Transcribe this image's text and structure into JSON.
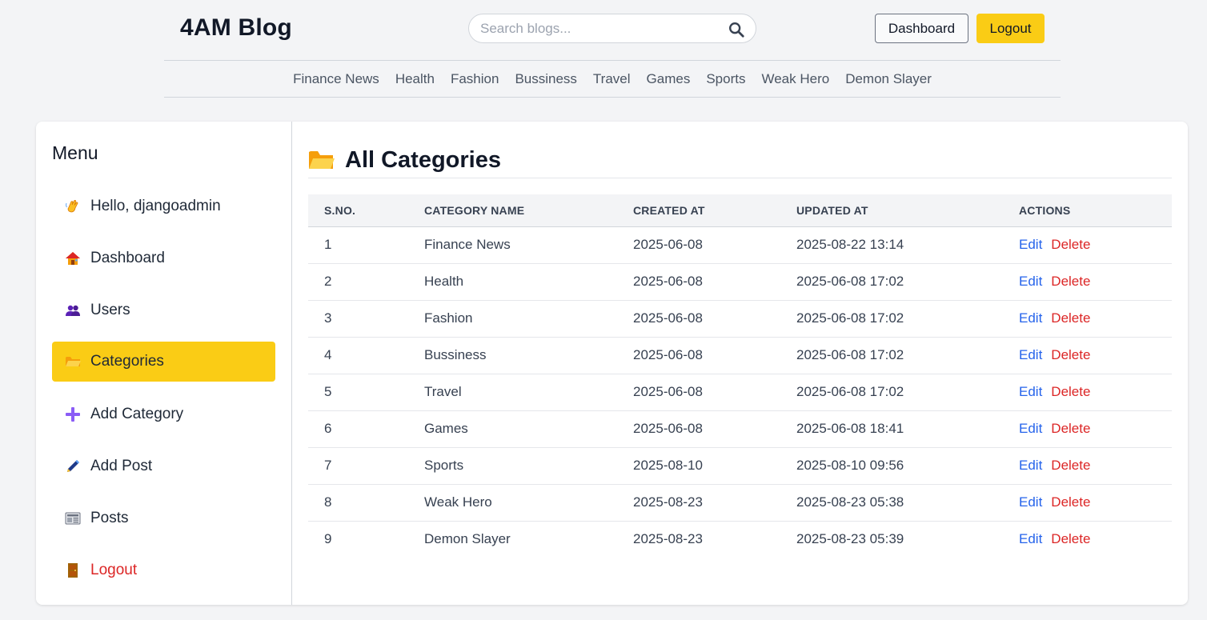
{
  "header": {
    "brand": "4AM Blog",
    "search_placeholder": "Search blogs...",
    "dashboard_label": "Dashboard",
    "logout_label": "Logout",
    "logout_color": "#facc15"
  },
  "nav": [
    "Finance News",
    "Health",
    "Fashion",
    "Bussiness",
    "Travel",
    "Games",
    "Sports",
    "Weak Hero",
    "Demon Slayer"
  ],
  "sidebar": {
    "title": "Menu",
    "items": [
      {
        "label": "Hello, djangoadmin",
        "icon": "waving-hand-icon"
      },
      {
        "label": "Dashboard",
        "icon": "house-icon"
      },
      {
        "label": "Users",
        "icon": "users-icon"
      },
      {
        "label": "Categories",
        "icon": "folder-icon",
        "active": true
      },
      {
        "label": "Add Category",
        "icon": "plus-icon"
      },
      {
        "label": "Add Post",
        "icon": "pen-icon"
      },
      {
        "label": "Posts",
        "icon": "newspaper-icon"
      },
      {
        "label": "Logout",
        "icon": "door-icon"
      }
    ]
  },
  "main": {
    "title": "All Categories",
    "columns": [
      "S.NO.",
      "CATEGORY NAME",
      "CREATED AT",
      "UPDATED AT",
      "ACTIONS"
    ],
    "edit_label": "Edit",
    "delete_label": "Delete",
    "rows": [
      {
        "sno": "1",
        "name": "Finance News",
        "created": "2025-06-08",
        "updated": "2025-08-22 13:14"
      },
      {
        "sno": "2",
        "name": "Health",
        "created": "2025-06-08",
        "updated": "2025-06-08 17:02"
      },
      {
        "sno": "3",
        "name": "Fashion",
        "created": "2025-06-08",
        "updated": "2025-06-08 17:02"
      },
      {
        "sno": "4",
        "name": "Bussiness",
        "created": "2025-06-08",
        "updated": "2025-06-08 17:02"
      },
      {
        "sno": "5",
        "name": "Travel",
        "created": "2025-06-08",
        "updated": "2025-06-08 17:02"
      },
      {
        "sno": "6",
        "name": "Games",
        "created": "2025-06-08",
        "updated": "2025-06-08 18:41"
      },
      {
        "sno": "7",
        "name": "Sports",
        "created": "2025-08-10",
        "updated": "2025-08-10 09:56"
      },
      {
        "sno": "8",
        "name": "Weak Hero",
        "created": "2025-08-23",
        "updated": "2025-08-23 05:38"
      },
      {
        "sno": "9",
        "name": "Demon Slayer",
        "created": "2025-08-23",
        "updated": "2025-08-23 05:39"
      }
    ]
  }
}
